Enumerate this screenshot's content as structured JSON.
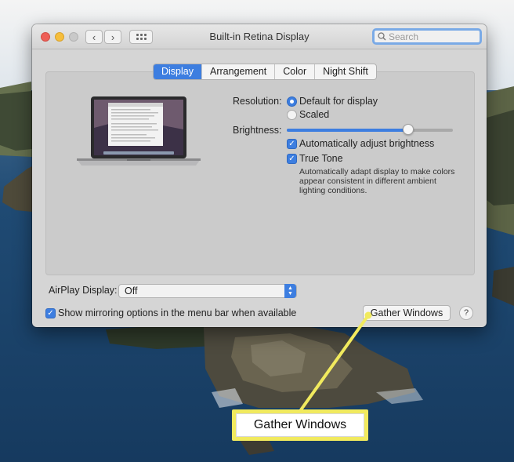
{
  "window": {
    "title": "Built-in Retina Display"
  },
  "search": {
    "placeholder": "Search"
  },
  "tabs": [
    {
      "label": "Display",
      "active": true
    },
    {
      "label": "Arrangement",
      "active": false
    },
    {
      "label": "Color",
      "active": false
    },
    {
      "label": "Night Shift",
      "active": false
    }
  ],
  "resolution": {
    "label": "Resolution:",
    "options": [
      {
        "label": "Default for display",
        "selected": true
      },
      {
        "label": "Scaled",
        "selected": false
      }
    ]
  },
  "brightness": {
    "label": "Brightness:",
    "level": 0.73,
    "auto_adjust": {
      "label": "Automatically adjust brightness",
      "checked": true
    }
  },
  "true_tone": {
    "label": "True Tone",
    "checked": true,
    "description": "Automatically adapt display to make colors appear consistent in different ambient lighting conditions."
  },
  "airplay": {
    "label": "AirPlay Display:",
    "value": "Off"
  },
  "mirroring": {
    "label": "Show mirroring options in the menu bar when available",
    "checked": true
  },
  "buttons": {
    "gather_windows": "Gather Windows",
    "help": "?"
  },
  "callout": {
    "label": "Gather Windows",
    "color": "#f1ea5e"
  },
  "colors": {
    "accent": "#3d7ee0"
  }
}
